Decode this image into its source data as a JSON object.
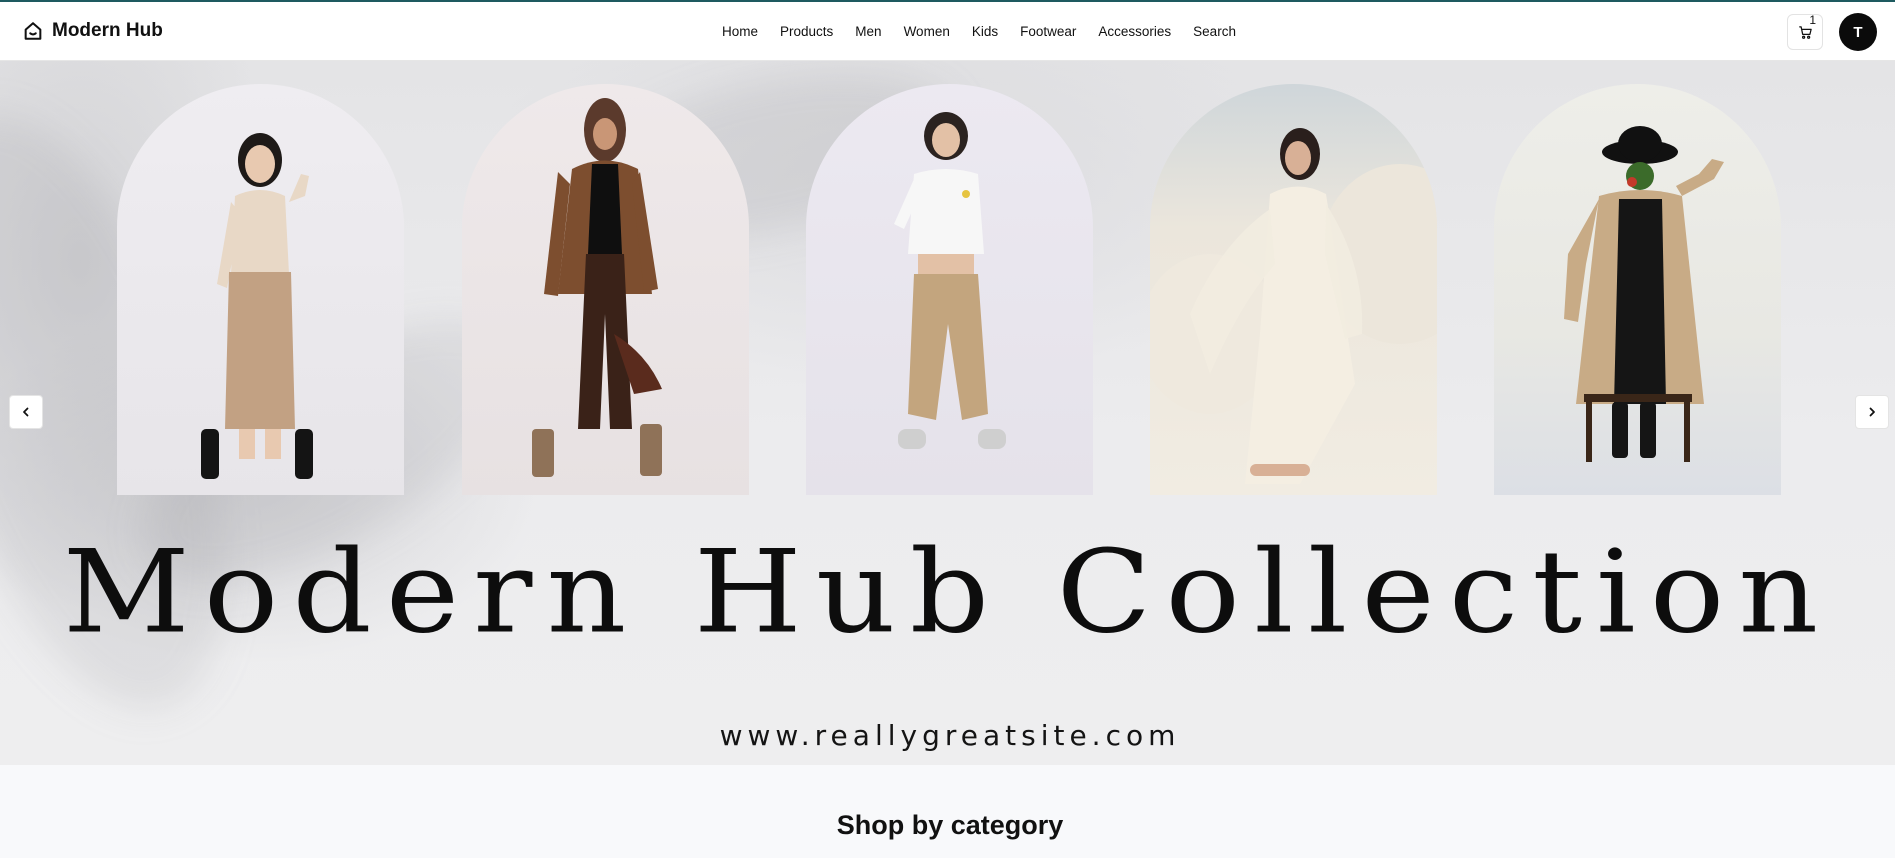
{
  "header": {
    "brand": "Modern Hub",
    "nav": [
      "Home",
      "Products",
      "Men",
      "Women",
      "Kids",
      "Footwear",
      "Accessories",
      "Search"
    ],
    "cart_count": "1",
    "avatar_initial": "T"
  },
  "hero": {
    "title": "Modern Hub Collection",
    "url": "www.reallygreatsite.com",
    "prev_icon": "chevron-left-icon",
    "next_icon": "chevron-right-icon"
  },
  "categories": {
    "title": "Shop by category"
  },
  "colors": {
    "accent_border": "#1e5a60",
    "avatar_bg": "#0b0b0b"
  }
}
